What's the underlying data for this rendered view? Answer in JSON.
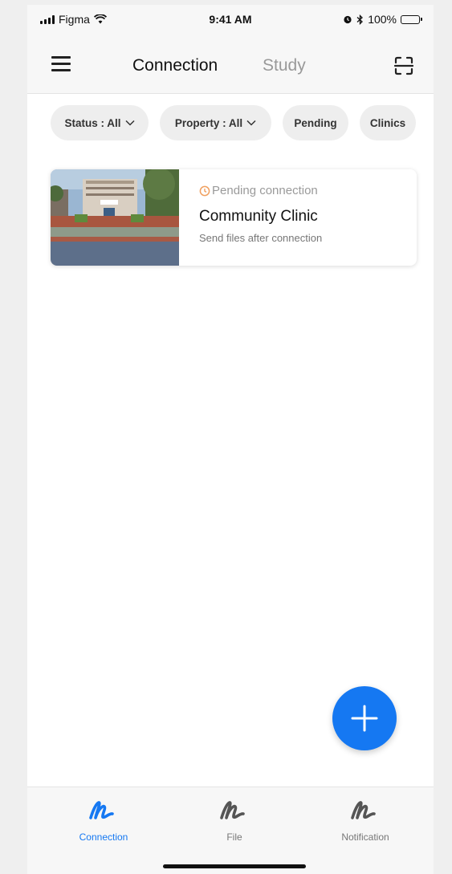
{
  "status_bar": {
    "carrier": "Figma",
    "time": "9:41 AM",
    "battery": "100%"
  },
  "header": {
    "tabs": [
      {
        "label": "Connection",
        "active": true
      },
      {
        "label": "Study",
        "active": false
      }
    ],
    "menu_icon": "hamburger-menu-icon",
    "scan_icon": "scan-icon"
  },
  "filters": [
    {
      "label": "Status : All",
      "has_dropdown": true
    },
    {
      "label": "Property : All",
      "has_dropdown": true
    },
    {
      "label": "Pending",
      "has_dropdown": false
    },
    {
      "label": "Clinics",
      "has_dropdown": false
    }
  ],
  "cards": [
    {
      "status": "Pending connection",
      "title": "Community Clinic",
      "subtitle": "Send files after connection"
    }
  ],
  "fab": {
    "icon": "plus-icon"
  },
  "bottom_nav": [
    {
      "label": "Connection",
      "icon": "connection-icon",
      "active": true
    },
    {
      "label": "File",
      "icon": "file-icon",
      "active": false
    },
    {
      "label": "Notification",
      "icon": "notification-icon",
      "active": false
    }
  ],
  "colors": {
    "accent": "#1578f2",
    "pending": "#f0a060",
    "inactive_tab": "#999999"
  }
}
